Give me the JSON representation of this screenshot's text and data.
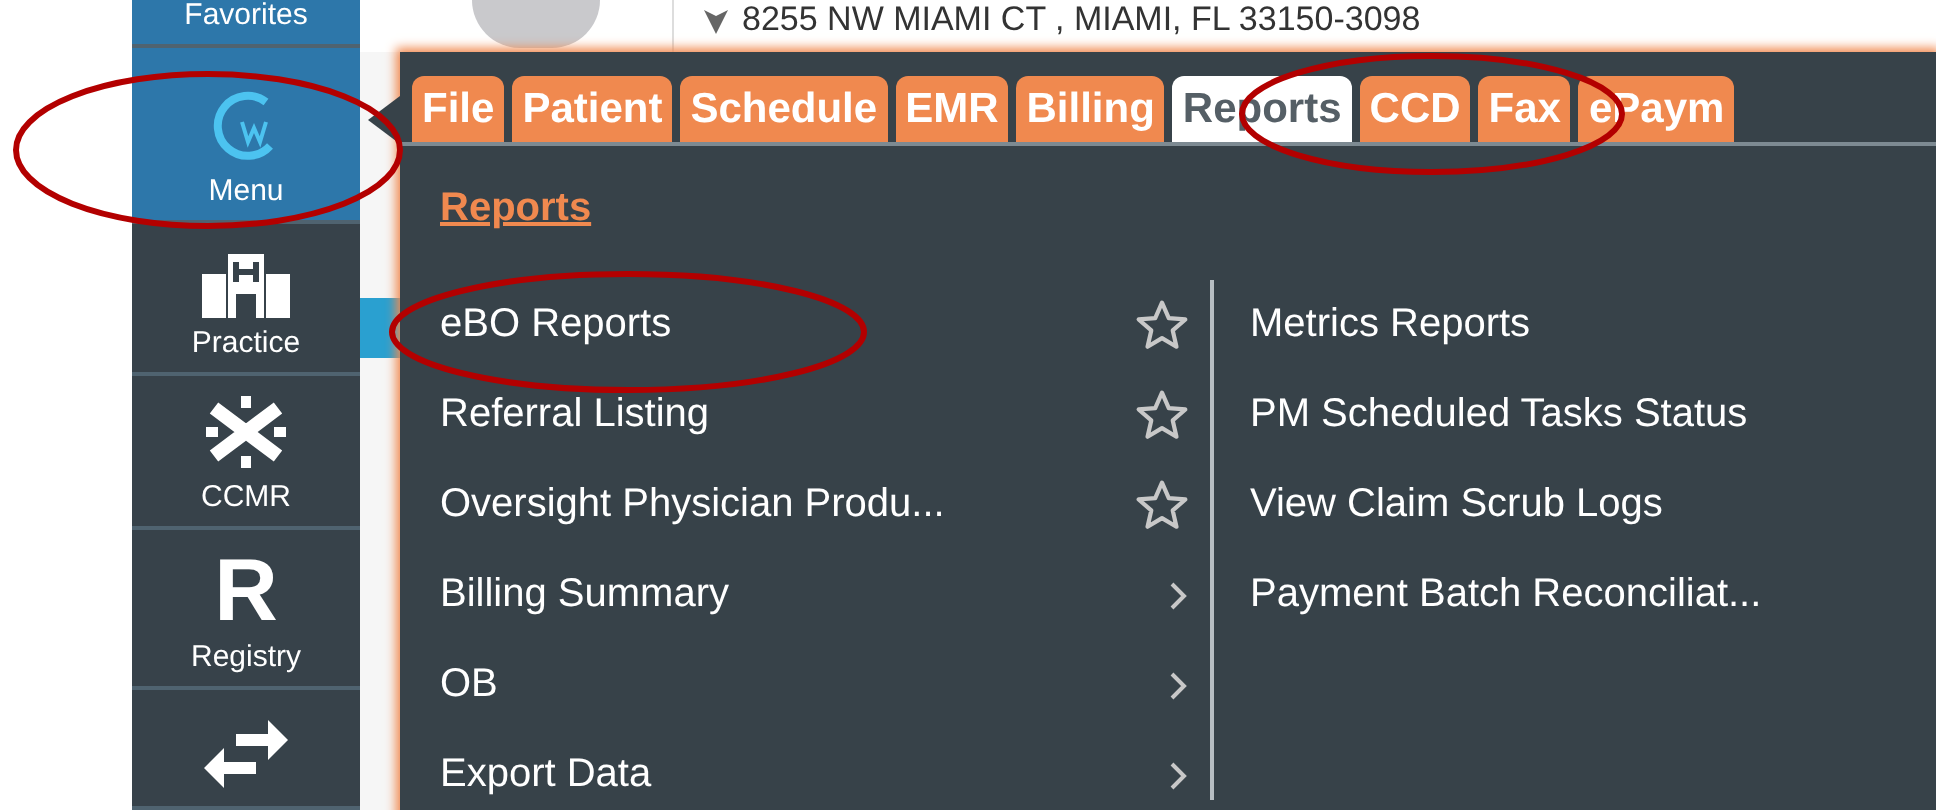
{
  "sidebar": {
    "items": [
      {
        "label": "Favorites",
        "selected": true
      },
      {
        "label": "Menu",
        "selected": true
      },
      {
        "label": "Practice",
        "selected": false
      },
      {
        "label": "CCMR",
        "selected": false
      },
      {
        "label": "Registry",
        "glyph": "R",
        "selected": false
      },
      {
        "selected": false
      }
    ]
  },
  "header": {
    "address": "8255 NW MIAMI CT , MIAMI, FL 33150-3098"
  },
  "menu": {
    "tabs": [
      {
        "label": "File",
        "selected": false
      },
      {
        "label": "Patient",
        "selected": false
      },
      {
        "label": "Schedule",
        "selected": false
      },
      {
        "label": "EMR",
        "selected": false
      },
      {
        "label": "Billing",
        "selected": false
      },
      {
        "label": "Reports",
        "selected": true
      },
      {
        "label": "CCD",
        "selected": false
      },
      {
        "label": "Fax",
        "selected": false
      },
      {
        "label": "ePaym",
        "selected": false
      }
    ],
    "heading": "Reports",
    "left_items": [
      {
        "label": "eBO Reports",
        "kind": "favorite"
      },
      {
        "label": "Referral Listing",
        "kind": "favorite"
      },
      {
        "label": "Oversight Physician Produ...",
        "kind": "favorite"
      },
      {
        "label": "Billing Summary",
        "kind": "submenu"
      },
      {
        "label": "OB",
        "kind": "submenu"
      },
      {
        "label": "Export Data",
        "kind": "submenu"
      }
    ],
    "right_items": [
      {
        "label": "Metrics Reports"
      },
      {
        "label": "PM Scheduled Tasks Status"
      },
      {
        "label": "View Claim Scrub Logs"
      },
      {
        "label": "Payment Batch Reconciliat..."
      }
    ]
  }
}
